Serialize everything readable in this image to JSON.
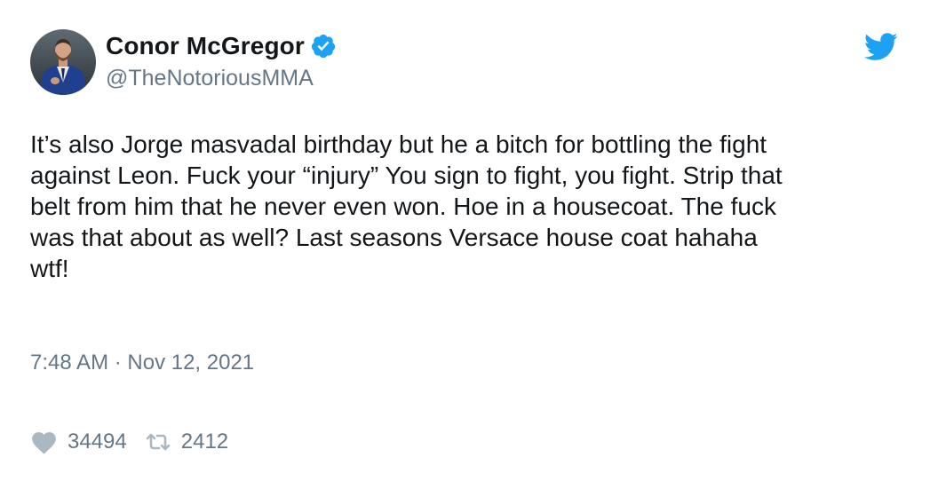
{
  "author": {
    "name": "Conor McGregor",
    "handle": "@TheNotoriousMMA",
    "verified": true
  },
  "tweet": {
    "text_lines": [
      "It’s also Jorge masvadal birthday but he a bitch for bottling the fight",
      "against Leon. Fuck your “injury” You sign to fight, you fight. Strip that",
      "belt from him that he never even won. Hoe in a housecoat. The fuck",
      "was that about as well? Last seasons Versace house coat hahaha",
      "wtf!"
    ],
    "timestamp": "7:48 AM · Nov 12, 2021"
  },
  "actions": {
    "likes": "34494",
    "retweets": "2412"
  },
  "icons": {
    "brand": "twitter-bird-icon",
    "verified": "verified-badge-icon",
    "like": "heart-icon",
    "retweet": "retweet-icon"
  },
  "colors": {
    "brand_blue": "#1da1f2",
    "text_primary": "#14171a",
    "text_secondary": "#657786",
    "icon_gray": "#aab8c2"
  }
}
